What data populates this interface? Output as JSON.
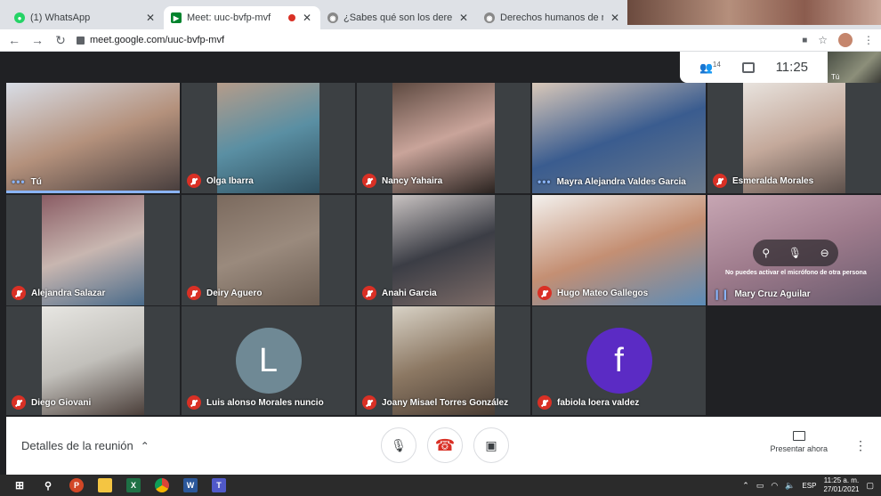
{
  "browser": {
    "tabs": [
      {
        "title": "(1) WhatsApp",
        "active": false,
        "recording": false,
        "favicon_color": "#25d366"
      },
      {
        "title": "Meet: uuc-bvfp-mvf",
        "active": true,
        "recording": true,
        "favicon_color": "#00832d"
      },
      {
        "title": "¿Sabes qué son los derechos de",
        "active": false,
        "recording": false,
        "favicon_color": "#888888"
      },
      {
        "title": "Derechos humanos de niñas y ni",
        "active": false,
        "recording": false,
        "favicon_color": "#888888"
      }
    ],
    "url": "meet.google.com/uuc-bvfp-mvf"
  },
  "meet": {
    "participants_count": "14",
    "clock": "11:25",
    "self_label": "Tú",
    "tiles": [
      {
        "name": "Tú",
        "status": "dots",
        "col": 0,
        "row": 0,
        "bg": [
          "#d8dde6",
          "#b4917c",
          "#453c3c"
        ]
      },
      {
        "name": "Olga Ibarra",
        "status": "muted",
        "col": 1,
        "row": 0,
        "bg": [
          "#b59c8a",
          "#5a8fa3",
          "#2f4f5f"
        ]
      },
      {
        "name": "Nancy Yahaira",
        "status": "muted",
        "col": 2,
        "row": 0,
        "bg": [
          "#5e4a41",
          "#c9a49a",
          "#2a2320"
        ]
      },
      {
        "name": "Mayra Alejandra Valdes Garcia",
        "status": "dots",
        "col": 3,
        "row": 0,
        "bg": [
          "#d9c8b9",
          "#3a5c8f",
          "#6b7a8c"
        ]
      },
      {
        "name": "Esmeralda Morales",
        "status": "muted",
        "col": 4,
        "row": 0,
        "bg": [
          "#e8e3de",
          "#c4a99b",
          "#5c504b"
        ]
      },
      {
        "name": "Alejandra Salazar",
        "status": "muted",
        "col": 0,
        "row": 1,
        "bg": [
          "#8a5c64",
          "#c8b6b0",
          "#4a6b8a"
        ]
      },
      {
        "name": "Deiry Aguero",
        "status": "muted",
        "col": 1,
        "row": 1,
        "bg": [
          "#7b6a5e",
          "#9a8a7d",
          "#6b5d52"
        ]
      },
      {
        "name": "Anahi Garcia",
        "status": "muted",
        "col": 2,
        "row": 1,
        "bg": [
          "#c9c3c2",
          "#3b3d45",
          "#7c6b67"
        ]
      },
      {
        "name": "Hugo Mateo Gallegos",
        "status": "muted",
        "col": 3,
        "row": 1,
        "bg": [
          "#f3f1ee",
          "#c48f73",
          "#5c8cb7"
        ]
      },
      {
        "name": "Mary Cruz Aguilar",
        "status": "speaking",
        "col": 4,
        "row": 1,
        "bg": [
          "#c7a6b3",
          "#9e7b8c",
          "#6a5b6e"
        ]
      },
      {
        "name": "Diego Giovani",
        "status": "muted",
        "col": 0,
        "row": 2,
        "bg": [
          "#e7e6e2",
          "#c2c0bb",
          "#4b3f3a"
        ]
      },
      {
        "name": "Luis alonso Morales nuncio",
        "status": "muted",
        "col": 1,
        "row": 2,
        "avatar_letter": "L",
        "avatar_color": "#6f8995"
      },
      {
        "name": "Joany Misael Torres González",
        "status": "muted",
        "col": 2,
        "row": 2,
        "bg": [
          "#d8d2c6",
          "#8c7863",
          "#4a3d34"
        ]
      },
      {
        "name": "fabiola loera valdez",
        "status": "muted",
        "col": 3,
        "row": 2,
        "avatar_letter": "f",
        "avatar_color": "#5b2bc4"
      }
    ],
    "mic_notice": "No puedes activar el micrófono de otra persona"
  },
  "bottom_bar": {
    "details_label": "Detalles de la reunión",
    "present_label": "Presentar ahora"
  },
  "taskbar": {
    "language": "ESP",
    "time": "11:25 a. m.",
    "date": "27/01/2021"
  }
}
